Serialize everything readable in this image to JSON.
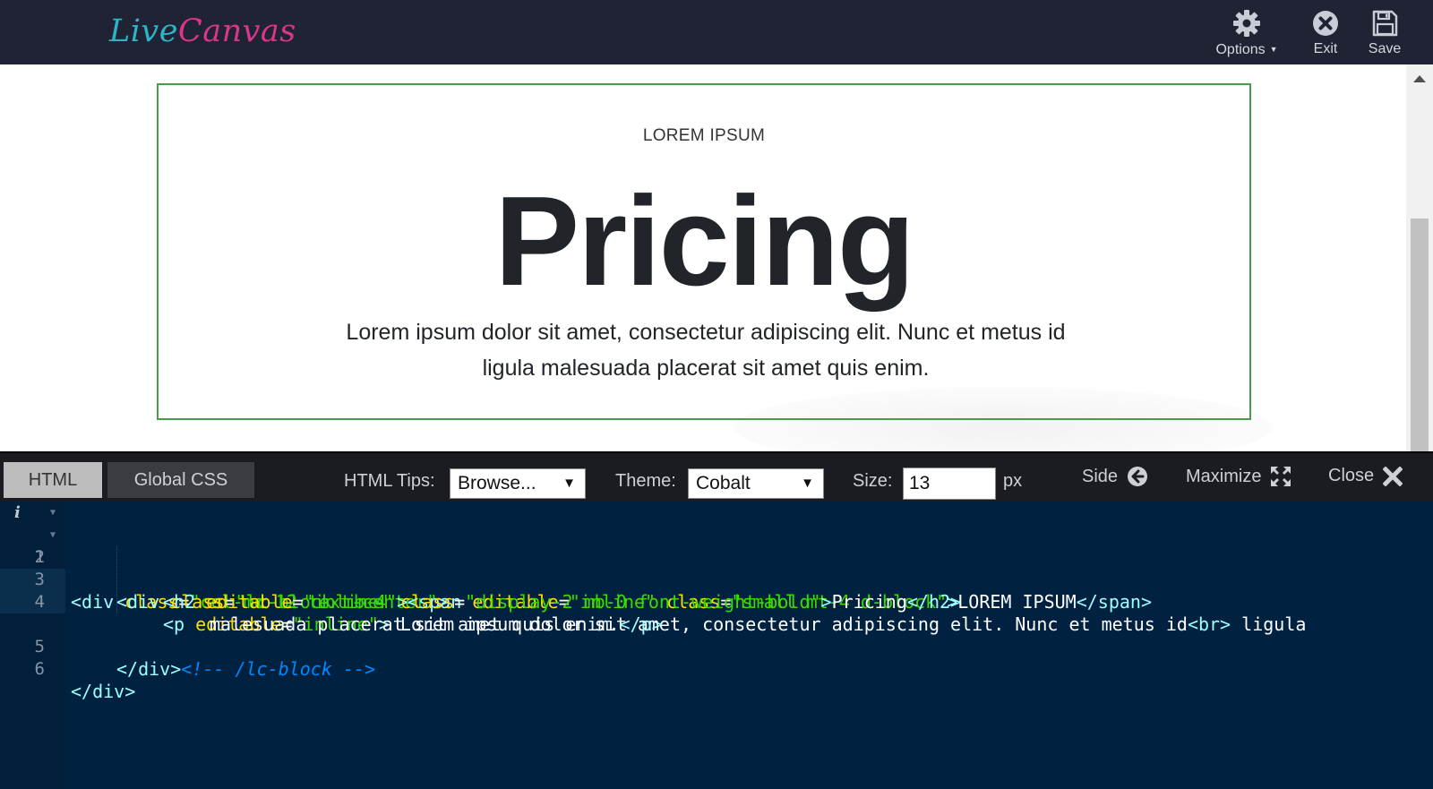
{
  "topbar": {
    "logo_part1": "Live",
    "logo_part2": "Canvas",
    "options_label": "Options",
    "exit_label": "Exit",
    "save_label": "Save"
  },
  "preview": {
    "small_label": "LOREM IPSUM",
    "title": "Pricing",
    "lead_line1": "Lorem ipsum dolor sit amet, consectetur adipiscing elit. Nunc et metus id",
    "lead_line2": "ligula malesuada placerat sit amet quis enim."
  },
  "editor": {
    "tabs": [
      {
        "label": "HTML",
        "active": true
      },
      {
        "label": "Global CSS",
        "active": false
      }
    ],
    "html_tips_label": "HTML Tips:",
    "html_tips_value": "Browse...",
    "theme_label": "Theme:",
    "theme_value": "Cobalt",
    "size_label": "Size:",
    "size_value": "13",
    "size_unit": "px",
    "side_label": "Side",
    "maximize_label": "Maximize",
    "close_label": "Close",
    "line_numbers": [
      "1",
      "2",
      "3",
      "4",
      "5",
      "6"
    ],
    "code": {
      "l1": {
        "t1": "<div",
        "a1": " class",
        "e1": "=",
        "s1": "\"col-md-12 text-center\"",
        "t2": ">"
      },
      "l2": {
        "t1": "<div",
        "a1": " class",
        "e1": "=",
        "s1": "\"lc-block mb-4\"",
        "t2": "><span",
        "a2": " editable",
        "e2": "=",
        "s2": "\"inline\"",
        "a3": " class",
        "e3": "=",
        "s3": "\"small mt-4 d-block\"",
        "t3": ">",
        "x1": "LOREM IPSUM",
        "t4": "</span>"
      },
      "l3": {
        "t1": "<h2",
        "a1": " editable",
        "e1": "=",
        "s1": "\"inline\"",
        "a2": " class",
        "e2": "=",
        "s2": "\"display-2 mb-0 font-weight-bold\"",
        "t2": ">",
        "x1": "Pricing",
        "t3": "</h2>"
      },
      "l4": {
        "t1": "<p",
        "a1": " editable",
        "e1": "=",
        "s1": "\"inline\"",
        "t2": ">",
        "x1": " Lorem ipsum dolor sit amet, consectetur adipiscing elit. Nunc et metus id",
        "t3": "<br>",
        "x2": " ligula"
      },
      "l4b": {
        "x1": "malesuada placerat sit amet quis enim.",
        "t1": "</p>"
      },
      "l5": {
        "t1": "</div>",
        "c1": "<!-- /lc-block -->"
      },
      "l6": {
        "t1": "</div>"
      }
    }
  },
  "colors": {
    "topbar_bg": "#202333",
    "logo_live": "#2cb5c9",
    "logo_canvas": "#d8378a",
    "selection_border": "#4a9b4e",
    "editor_bg_cobalt": "#002240",
    "code_tag": "#9effff",
    "code_attr": "#ffdd00",
    "code_string": "#3ad900",
    "code_comment": "#0088ff"
  },
  "icons": [
    "gear-icon",
    "exit-icon",
    "save-icon",
    "arrow-left-circle-icon",
    "maximize-icon",
    "close-x-icon",
    "info-icon",
    "fold-arrow-icon"
  ]
}
